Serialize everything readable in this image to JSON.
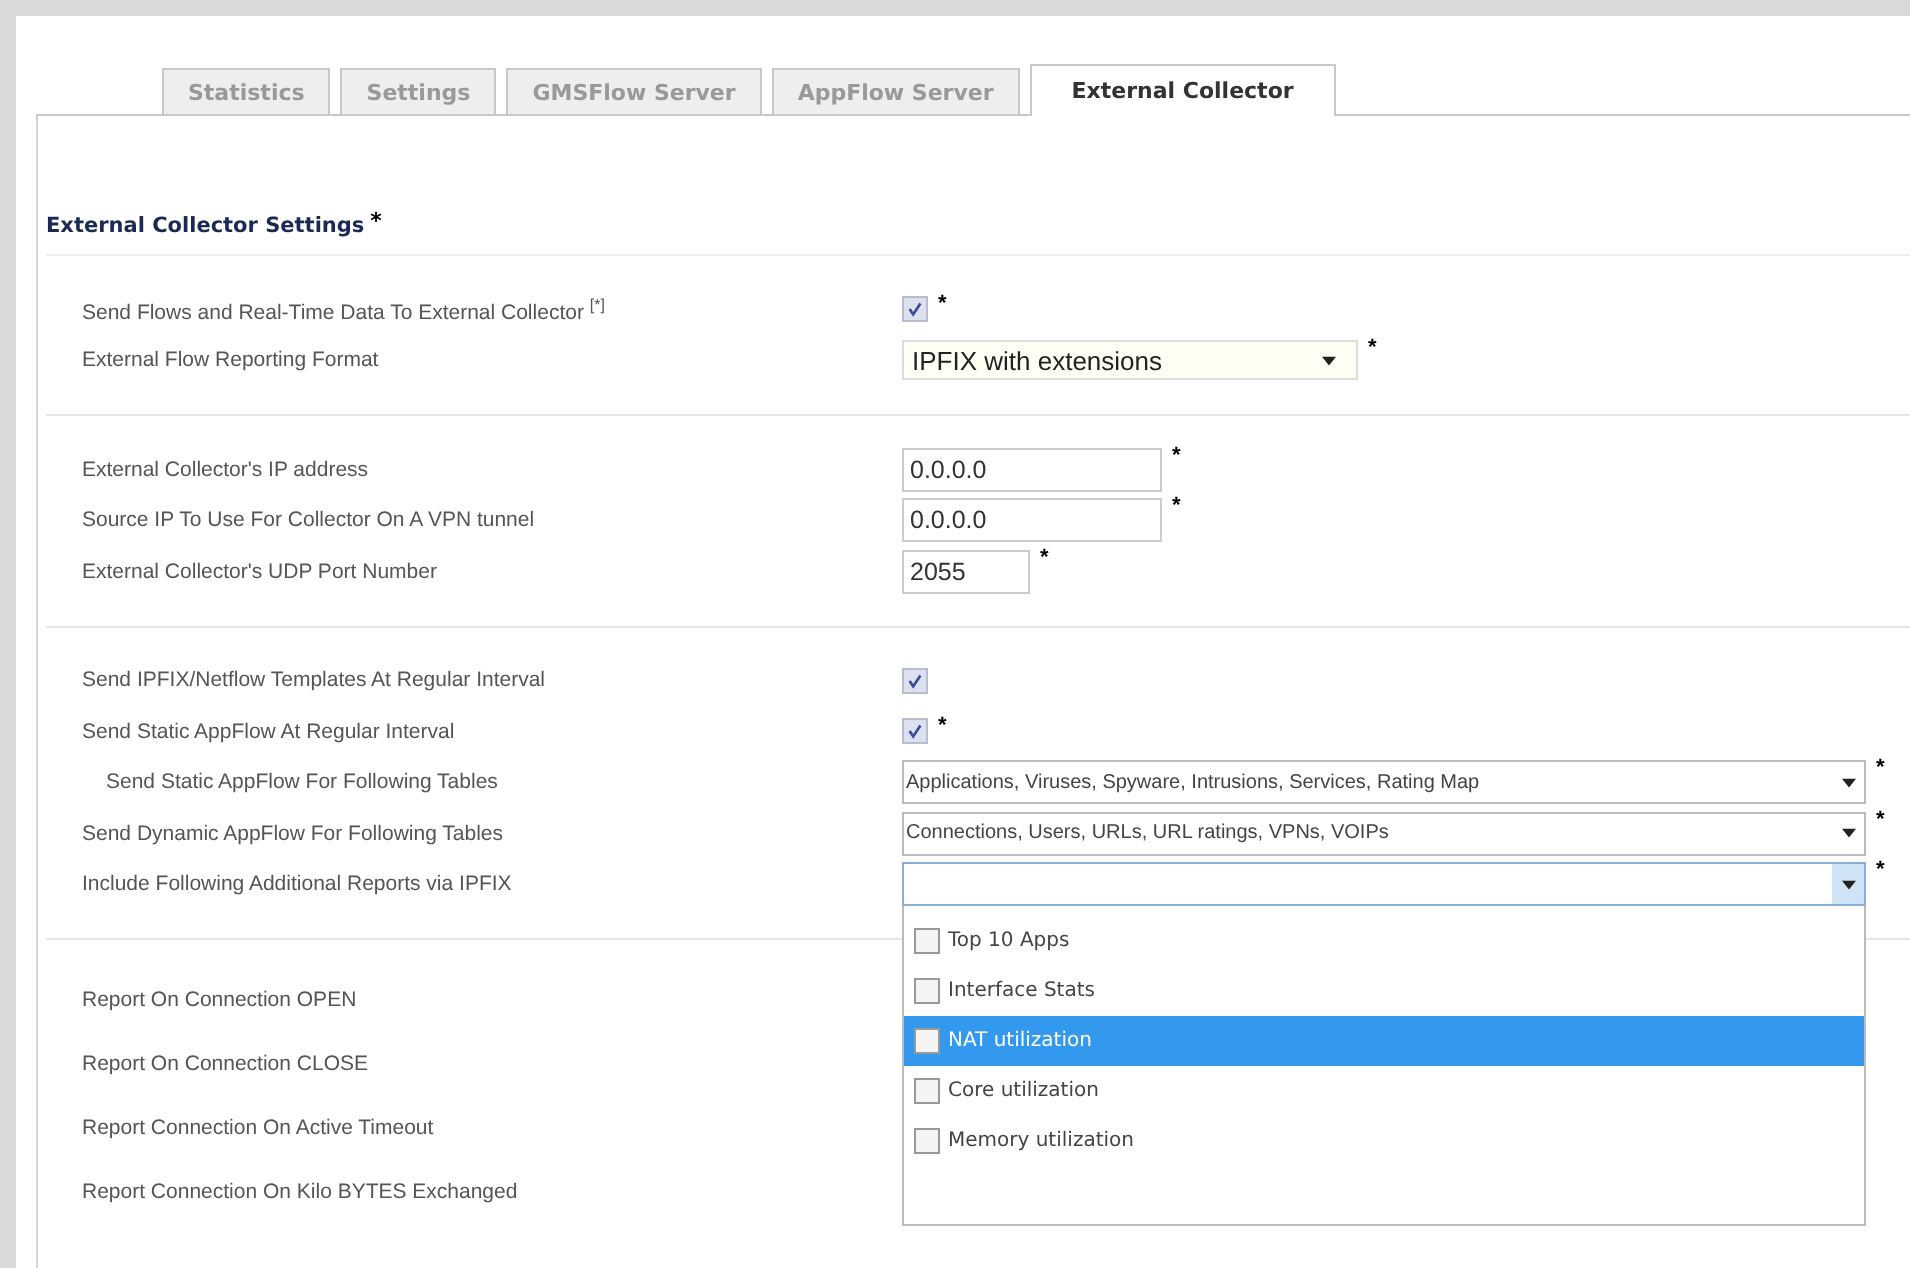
{
  "tabs": [
    {
      "label": "Statistics",
      "selected": false
    },
    {
      "label": "Settings",
      "selected": false
    },
    {
      "label": "GMSFlow Server",
      "selected": false
    },
    {
      "label": "AppFlow Server",
      "selected": false
    },
    {
      "label": "External Collector",
      "selected": true
    }
  ],
  "heading": {
    "text": "External Collector Settings",
    "mark": "*"
  },
  "groups": [
    {
      "rows": [
        {
          "label": "Send Flows and Real-Time Data To External Collector $^{[*]}$",
          "kind": "checkbox",
          "checked": true,
          "mark": "*"
        },
        {
          "label": "External Flow Reporting Format",
          "kind": "select",
          "value": "IPFIX with extensions",
          "mark": "*"
        }
      ]
    },
    {
      "rows": [
        {
          "label": "External Collector's IP address",
          "kind": "text",
          "value": "0.0.0.0",
          "mark": "*"
        },
        {
          "label": "Source IP To Use For Collector On A VPN tunnel",
          "kind": "text",
          "value": "0.0.0.0",
          "mark": "*"
        },
        {
          "label": "External Collector's UDP Port Number",
          "kind": "port",
          "value": "2055",
          "mark": "*"
        }
      ]
    },
    {
      "rows": [
        {
          "label": "Send IPFIX/Netflow Templates At Regular Interval",
          "kind": "checkbox",
          "checked": true
        },
        {
          "label": "Send Static AppFlow At Regular Interval",
          "kind": "checkbox",
          "checked": true,
          "mark": "*"
        },
        {
          "label": "Send Static AppFlow For Following Tables",
          "kind": "multiselect",
          "indented": true,
          "value": "Applications, Viruses, Spyware, Intrusions, Services, Rating Map",
          "mark": "*"
        },
        {
          "label": "Send Dynamic AppFlow For Following Tables",
          "kind": "multiselect",
          "value": "Connections, Users, URLs, URL ratings, VPNs, VOIPs",
          "mark": "*"
        },
        {
          "label": "Include Following Additional Reports via IPFIX",
          "kind": "multiselect",
          "mark": "*",
          "expanded": true,
          "options": [
            {
              "label": "Top 10 Apps",
              "checked": false,
              "selected": false
            },
            {
              "label": "Interface Stats",
              "checked": false,
              "selected": false
            },
            {
              "label": "NAT utilization",
              "checked": false,
              "selected": true
            },
            {
              "label": "Core utilization",
              "checked": false,
              "selected": false
            },
            {
              "label": "Memory utilization",
              "checked": false,
              "selected": false
            }
          ]
        }
      ]
    },
    {
      "rows": [
        {
          "label": "Report On Connection OPEN",
          "kind": "label"
        },
        {
          "label": "Report On Connection CLOSE",
          "kind": "label"
        },
        {
          "label": "Report Connection On Active Timeout",
          "kind": "label"
        },
        {
          "label": "Report Connection On Kilo BYTES Exchanged",
          "kind": "label"
        }
      ]
    }
  ]
}
